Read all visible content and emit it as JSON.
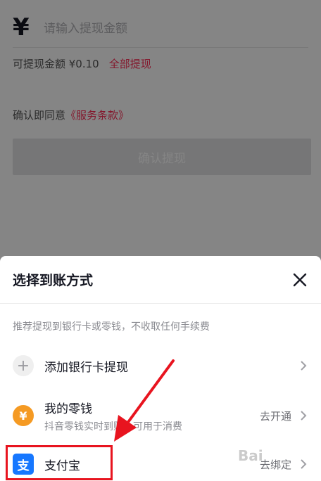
{
  "form": {
    "currency_symbol": "¥",
    "amount_placeholder": "请输入提现金额",
    "balance_text": "可提现金额 ¥0.10",
    "withdraw_all_label": "全部提现",
    "agree_text": "确认即同意",
    "terms_link": "《服务条款》",
    "confirm_button": "确认提现"
  },
  "sheet": {
    "title": "选择到账方式",
    "hint": "推荐提现到银行卡或零钱，不收取任何手续费",
    "methods": [
      {
        "label": "添加银行卡提现",
        "icon": "plus-icon"
      },
      {
        "label": "我的零钱",
        "subtitle": "抖音零钱实时到账，可用于消费",
        "action": "去开通",
        "icon": "yen-icon"
      },
      {
        "label": "支付宝",
        "action": "去绑定",
        "icon": "alipay-icon"
      }
    ]
  },
  "icons": {
    "yen_glyph": "¥",
    "alipay_glyph": "支",
    "plus_glyph": "+"
  },
  "watermark": "Bai",
  "colors": {
    "accent_red": "#fe2c55",
    "alipay_blue": "#1677ff",
    "change_orange": "#f59a23",
    "annotation_red": "#e8141f"
  }
}
